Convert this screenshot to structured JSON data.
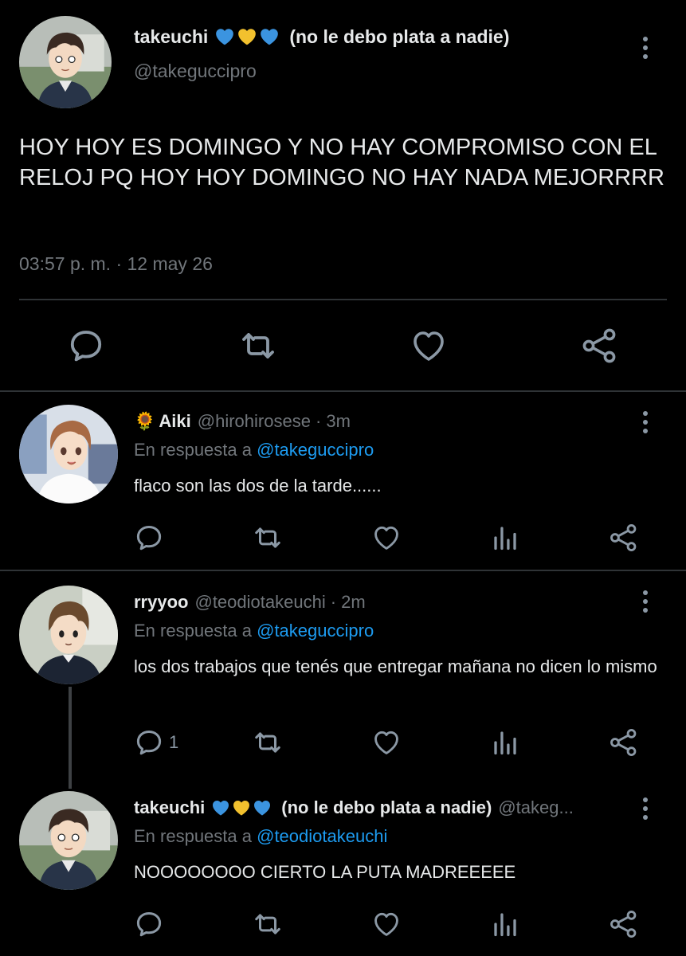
{
  "main_tweet": {
    "display_name": "takeuchi",
    "hearts": [
      "blue-heart",
      "yellow-heart",
      "blue-heart"
    ],
    "name_suffix": "(no le debo plata a nadie)",
    "handle": "@takeguccipro",
    "text": "HOY HOY ES DOMINGO Y NO HAY COMPROMISO CON EL RELOJ PQ HOY HOY DOMINGO NO HAY NADA MEJORRRR",
    "timestamp": "03:57 p. m. · 12 may 26"
  },
  "replies": [
    {
      "emoji": "🌻",
      "display_name": "Aiki",
      "handle": "@hirohirosese",
      "time": "· 3m",
      "replying_prefix": "En respuesta a",
      "replying_to": "@takeguccipro",
      "text": "flaco son las dos de la tarde......",
      "reply_count": ""
    },
    {
      "display_name": "rryyoo",
      "handle": "@teodiotakeuchi",
      "time": "· 2m",
      "replying_prefix": "En respuesta a",
      "replying_to": "@takeguccipro",
      "text": "los dos trabajos que tenés que entregar mañana no dicen lo mismo",
      "reply_count": "1"
    },
    {
      "display_name": "takeuchi",
      "name_suffix": "(no le debo plata a nadie)",
      "handle": "@takeg...",
      "replying_prefix": "En respuesta a",
      "replying_to": "@teodiotakeuchi",
      "text": "NOOOOOOOO CIERTO LA PUTA MADREEEEE",
      "reply_count": ""
    }
  ],
  "colors": {
    "background": "#000000",
    "text": "#e7e9ea",
    "muted": "#71767b",
    "accent": "#1d9bf0",
    "icon": "#8b98a5",
    "divider": "#2f3336"
  },
  "icons": {
    "reply": "comment-icon",
    "retweet": "retweet-icon",
    "like": "heart-icon",
    "views": "bar-chart-icon",
    "share": "share-icon",
    "menu": "more-vertical-icon"
  }
}
